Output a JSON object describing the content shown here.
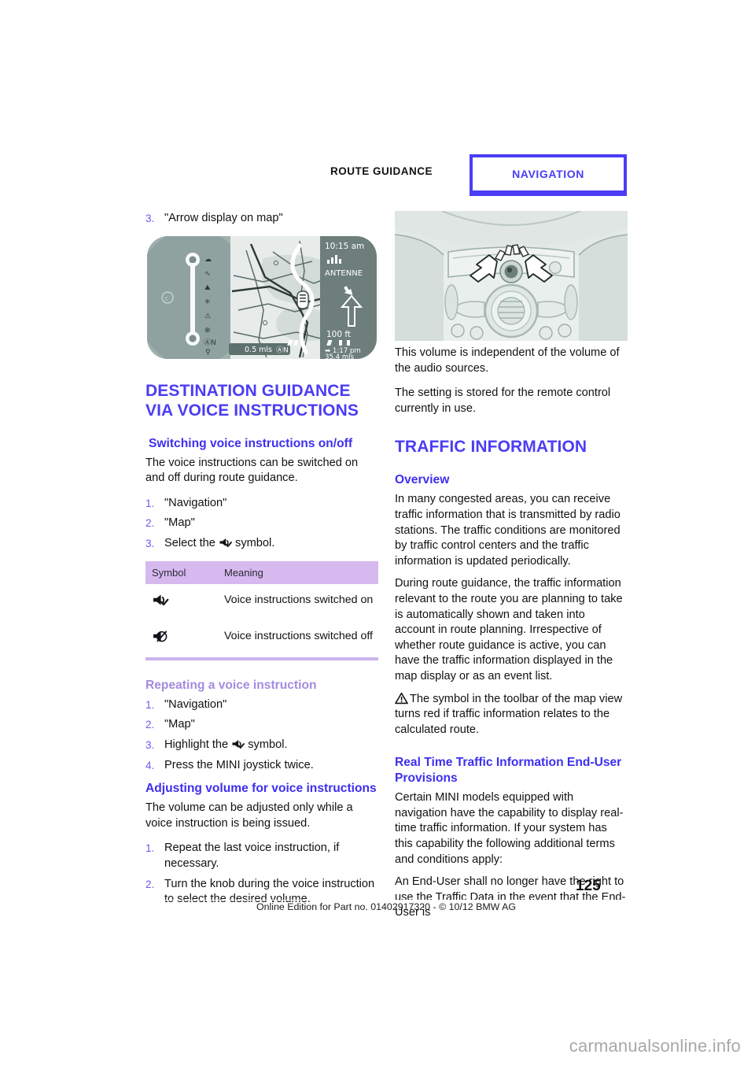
{
  "header": {
    "left_label": "ROUTE GUIDANCE",
    "tab_label": "NAVIGATION"
  },
  "left_column": {
    "step_continued": {
      "num": "3.",
      "text": "\"Arrow display on map\""
    },
    "figure_nav": {
      "name": "navigation-map-screen",
      "time": "10:15 am",
      "station": "ANTENNE",
      "scale": "100 ft",
      "distance_bar": "0.5 mls",
      "compass": "N",
      "eta": "1:17 pm",
      "remaining": "35.4 mls"
    },
    "section_title": "DESTINATION GUIDANCE VIA VOICE INSTRUCTIONS",
    "sub1": {
      "title": "Switching voice instructions on/off",
      "intro": "The voice instructions can be switched on and off during route guidance.",
      "steps": [
        {
          "num": "1.",
          "text": "\"Navigation\""
        },
        {
          "num": "2.",
          "text": "\"Map\""
        },
        {
          "num": "3.",
          "pre": " Select the ",
          "post": " symbol.",
          "icon": "speaker-on-icon"
        }
      ]
    },
    "table": {
      "headers": [
        "Symbol",
        "Meaning"
      ],
      "rows": [
        {
          "icon": "speaker-on-icon",
          "meaning": "Voice instructions switched on"
        },
        {
          "icon": "speaker-off-icon",
          "meaning": "Voice instructions switched off"
        }
      ]
    },
    "sub2": {
      "title": "Repeating a voice instruction",
      "steps": [
        {
          "num": "1.",
          "text": "\"Navigation\""
        },
        {
          "num": "2.",
          "text": "\"Map\""
        },
        {
          "num": "3.",
          "pre": " Highlight the ",
          "post": " symbol.",
          "icon": "speaker-on-icon"
        },
        {
          "num": "4.",
          "text": "Press the MINI joystick twice."
        }
      ]
    },
    "sub3": {
      "title": "Adjusting volume for voice instructions",
      "intro": "The volume can be adjusted only while a voice instruction is being issued.",
      "steps": [
        {
          "num": "1.",
          "text": "Repeat the last voice instruction, if necessary."
        },
        {
          "num": "2.",
          "text": "Turn the knob during the voice instruction to select the desired volume."
        }
      ]
    }
  },
  "right_column": {
    "figure_console": {
      "name": "center-console-volume-knob"
    },
    "para1": "This volume is independent of the volume of the audio sources.",
    "para2": "The setting is stored for the remote control currently in use.",
    "section_title": "TRAFFIC INFORMATION",
    "sub1": {
      "title": "Overview",
      "para1": "In many congested areas, you can receive traffic information that is transmitted by radio stations. The traffic conditions are monitored by traffic control centers and the traffic information is updated periodically.",
      "para2": "During route guidance, the traffic information relevant to the route you are planning to take is automatically shown and taken into account in route planning. Irrespective of whether route guidance is active, you can have the traffic information displayed in the map display or as an event list.",
      "note": "The symbol in the toolbar of the map view turns red if traffic information relates to the calculated route.",
      "note_icon": "warning-triangle-icon"
    },
    "sub2": {
      "title": "Real Time Traffic Information End-User Provisions",
      "para1": "Certain MINI models equipped with navigation have the capability to display real-time traffic information. If your system has this capability the following additional terms and conditions apply:",
      "para2": "An End-User shall no longer have the right to use the Traffic Data in the event that the End-User is"
    }
  },
  "footer": {
    "page_number": "125",
    "edition_note": "Online Edition for Part no. 01402917320 - © 10/12 BMW AG"
  },
  "watermark": "carmanualsonline.info",
  "colors": {
    "accent_blue": "#4b3df4",
    "accent_light_purple": "#a48bdf",
    "table_header": "#d6b9ef",
    "table_rule": "#cdb3ef"
  }
}
